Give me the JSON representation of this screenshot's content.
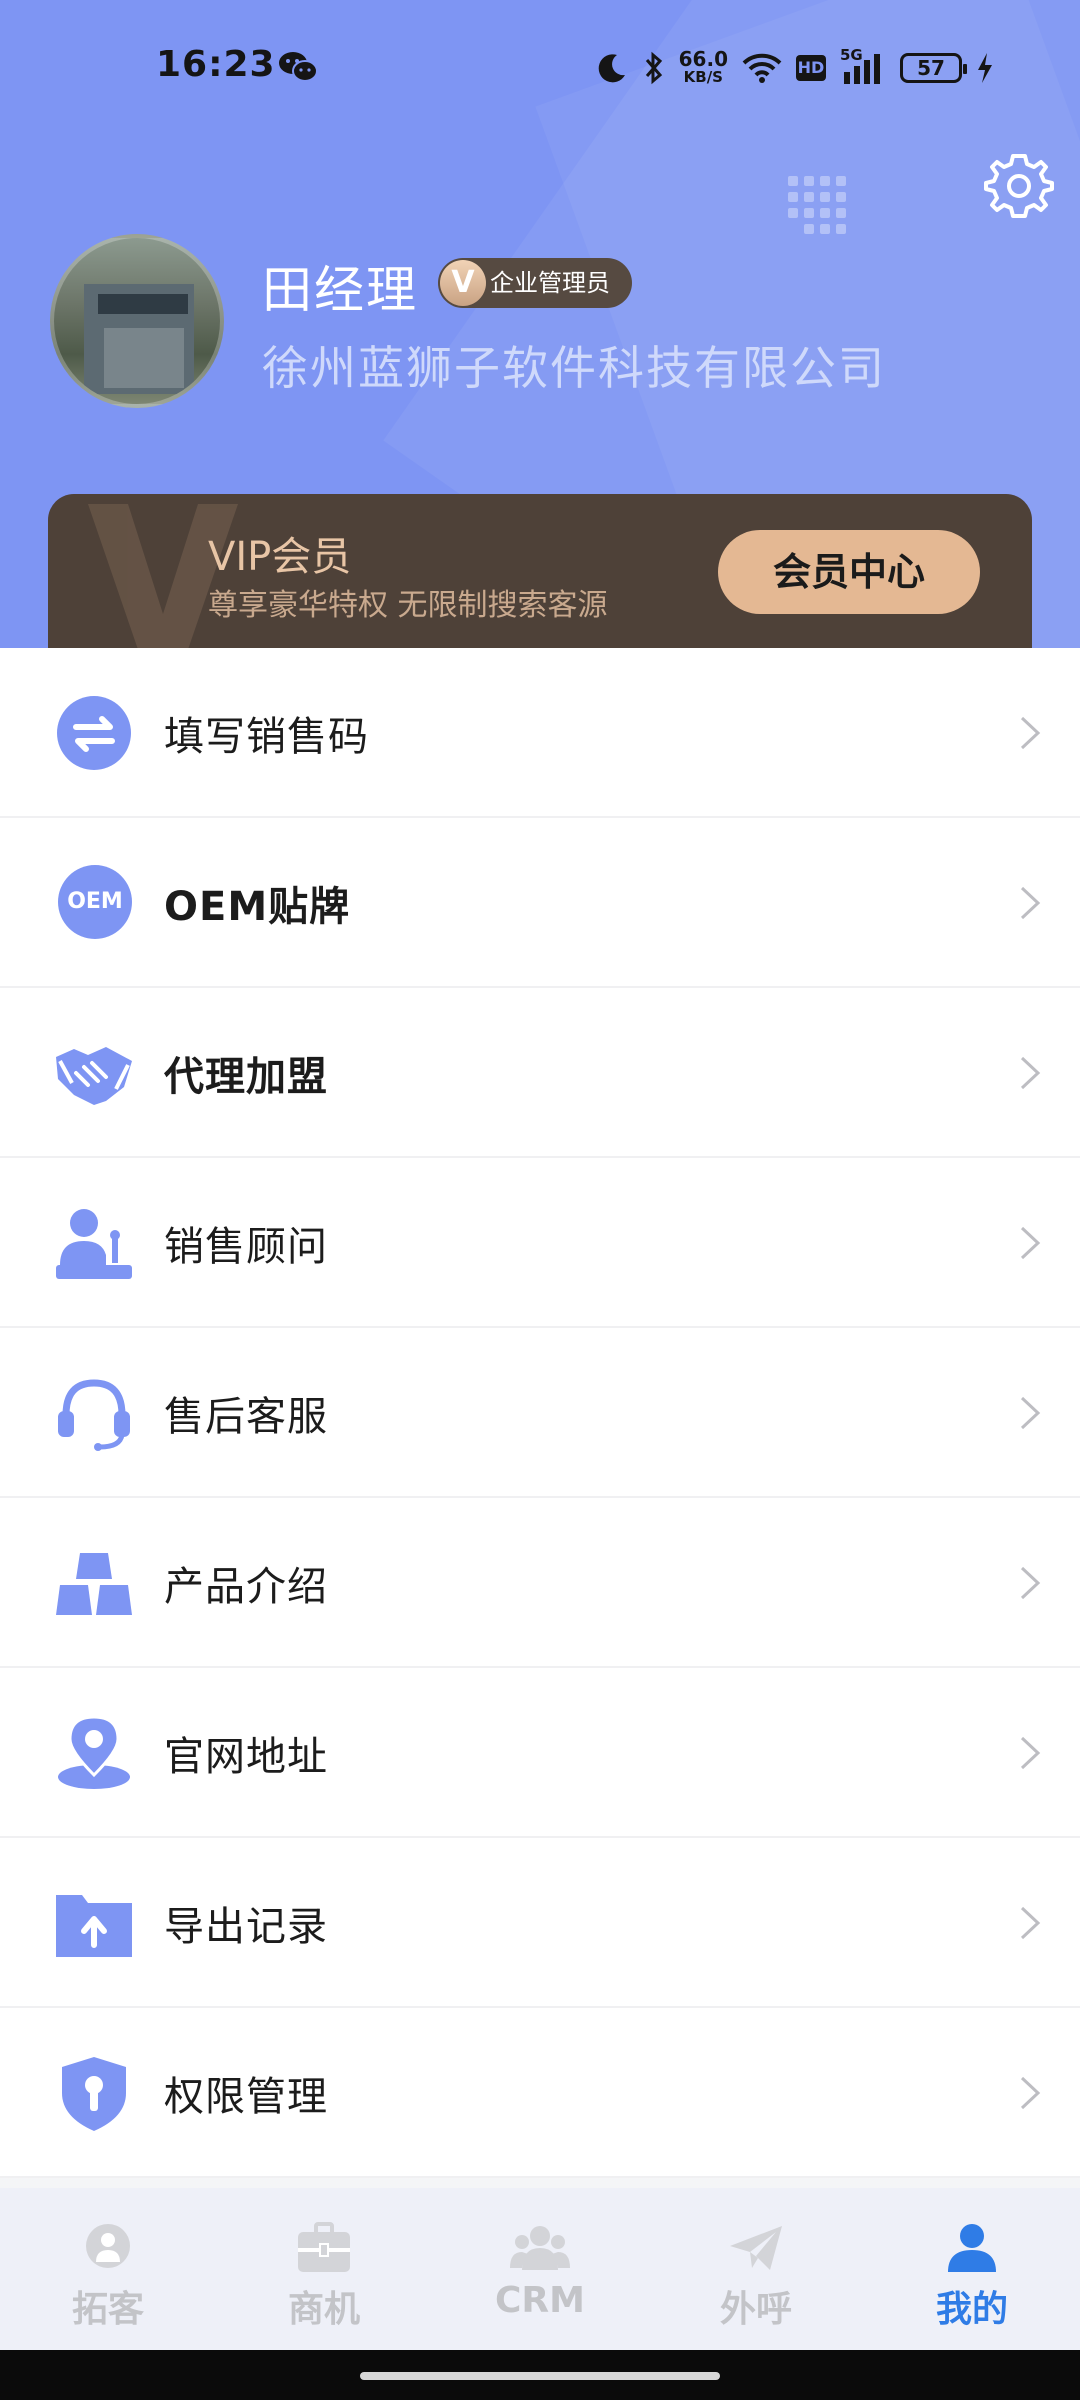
{
  "status_bar": {
    "time": "16:23",
    "net_speed": "66.0",
    "net_unit": "KB/S",
    "hd": "HD",
    "signal": "5G",
    "battery": "57"
  },
  "profile": {
    "name": "田经理",
    "badge_icon": "V",
    "badge": "企业管理员",
    "company": "徐州蓝狮子软件科技有限公司"
  },
  "vip": {
    "title": "VIP会员",
    "subtitle": "尊享豪华特权 无限制搜索客源",
    "button": "会员中心"
  },
  "menu": [
    {
      "label": "填写销售码",
      "icon": "swap-arrows-icon"
    },
    {
      "label": "OEM贴牌",
      "icon": "oem-icon",
      "icon_text": "OEM"
    },
    {
      "label": "代理加盟",
      "icon": "handshake-icon"
    },
    {
      "label": "销售顾问",
      "icon": "consultant-icon"
    },
    {
      "label": "售后客服",
      "icon": "headset-icon"
    },
    {
      "label": "产品介绍",
      "icon": "gold-bars-icon"
    },
    {
      "label": "官网地址",
      "icon": "location-pin-icon"
    },
    {
      "label": "导出记录",
      "icon": "folder-upload-icon"
    },
    {
      "label": "权限管理",
      "icon": "shield-key-icon"
    }
  ],
  "tabs": [
    {
      "label": "拓客",
      "icon": "customer-icon",
      "active": false
    },
    {
      "label": "商机",
      "icon": "briefcase-icon",
      "active": false
    },
    {
      "label": "CRM",
      "icon": "crm-people-icon",
      "active": false
    },
    {
      "label": "外呼",
      "icon": "paper-plane-icon",
      "active": false
    },
    {
      "label": "我的",
      "icon": "person-icon",
      "active": true
    }
  ],
  "colors": {
    "header_bg": "#7e95f3",
    "icon_blue": "#7e95f3",
    "vip_bg": "#4e4138",
    "vip_button": "#e4b893",
    "tab_active": "#2f7ce6",
    "tab_inactive": "#c3c4c8"
  }
}
